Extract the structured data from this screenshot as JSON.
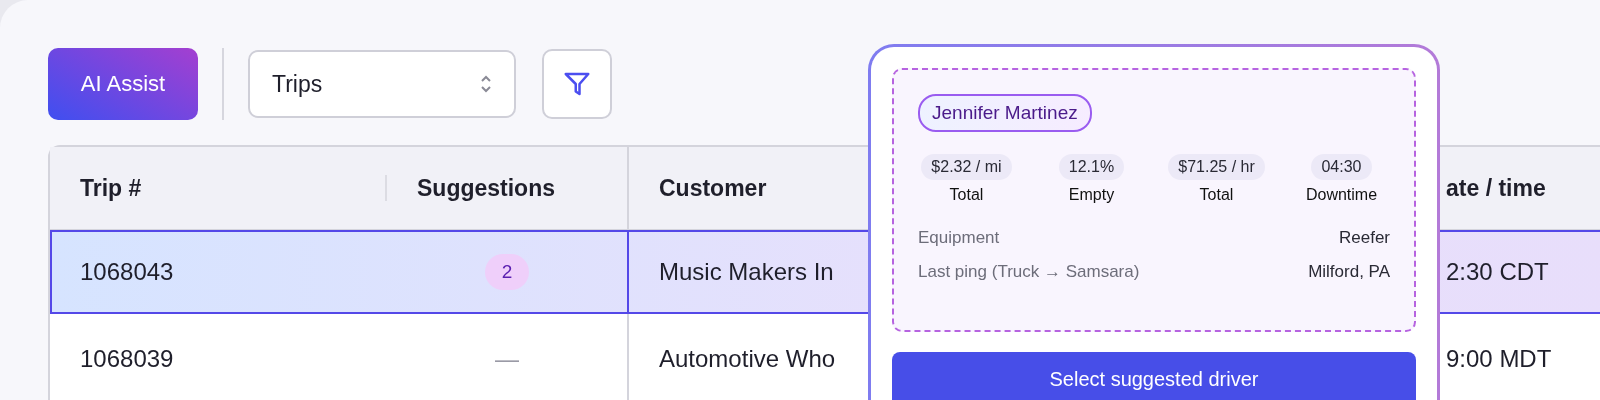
{
  "toolbar": {
    "ai_button": "AI Assist",
    "view_select": {
      "value": "Trips"
    }
  },
  "table": {
    "columns": [
      "Trip #",
      "Suggestions",
      "Customer",
      "ate / time"
    ],
    "rows": [
      {
        "selected": true,
        "trip": "1068043",
        "suggestions": "2",
        "customer": "Music Makers In",
        "datetime": "2:30 CDT"
      },
      {
        "selected": false,
        "trip": "1068039",
        "suggestions": "—",
        "customer": "Automotive Who",
        "datetime": "9:00 MDT"
      }
    ]
  },
  "popover": {
    "driver": "Jennifer Martinez",
    "stats": [
      {
        "value": "$2.32 / mi",
        "label": "Total"
      },
      {
        "value": "12.1%",
        "label": "Empty"
      },
      {
        "value": "$71.25 / hr",
        "label": "Total"
      },
      {
        "value": "04:30",
        "label": "Downtime"
      }
    ],
    "details": [
      {
        "label": "Equipment",
        "value": "Reefer"
      },
      {
        "label": "Last ping (Truck → Samsara)",
        "value": "Milford, PA"
      }
    ],
    "action": "Select suggested driver"
  }
}
